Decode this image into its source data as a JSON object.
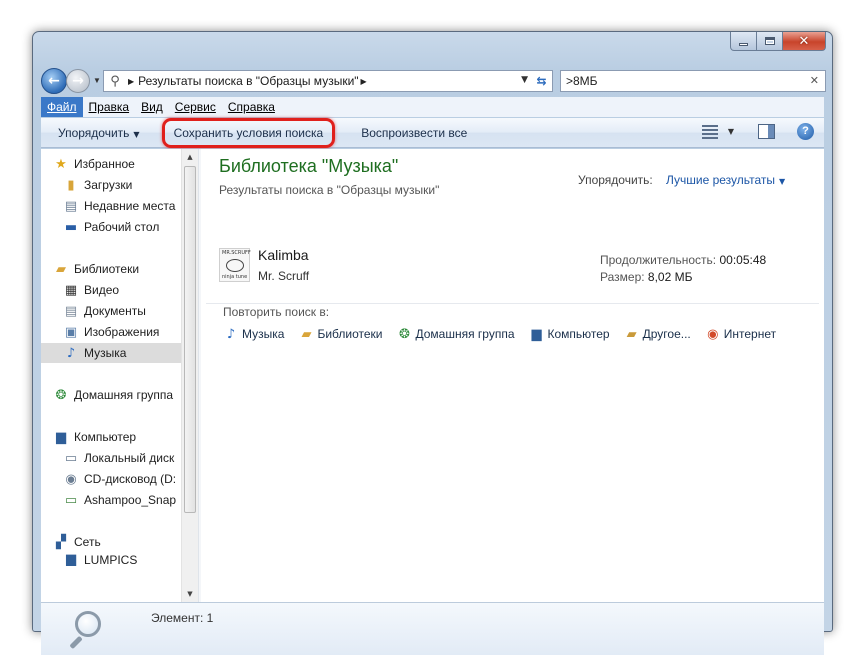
{
  "window": {
    "caption_buttons": [
      "minimize-icon",
      "maximize-icon",
      "close-icon"
    ]
  },
  "address": {
    "crumb": "Результаты поиска в \"Образцы музыки\"",
    "search_value": ">8МБ"
  },
  "menu": {
    "items": [
      "Файл",
      "Правка",
      "Вид",
      "Сервис",
      "Справка"
    ],
    "active": "Файл"
  },
  "toolbar": {
    "organize": "Упорядочить",
    "save_search": "Сохранить условия поиска",
    "play_all": "Воспроизвести все",
    "highlight_color": "#e0201c"
  },
  "navpane": {
    "items": [
      {
        "label": "Избранное",
        "icon": "star-icon"
      },
      {
        "label": "Загрузки",
        "icon": "downloads-folder-icon"
      },
      {
        "label": "Недавние места",
        "icon": "recent-places-icon"
      },
      {
        "label": "Рабочий стол",
        "icon": "desktop-icon"
      },
      {
        "label": "Библиотеки",
        "icon": "libraries-icon"
      },
      {
        "label": "Видео",
        "icon": "video-icon"
      },
      {
        "label": "Документы",
        "icon": "documents-icon"
      },
      {
        "label": "Изображения",
        "icon": "pictures-icon"
      },
      {
        "label": "Музыка",
        "icon": "music-icon",
        "selected": true
      },
      {
        "label": "Домашняя группа",
        "icon": "homegroup-icon"
      },
      {
        "label": "Компьютер",
        "icon": "computer-icon"
      },
      {
        "label": "Локальный диск",
        "icon": "local-disk-icon"
      },
      {
        "label": "CD-дисковод (D:",
        "icon": "cd-drive-icon"
      },
      {
        "label": "Ashampoo_Snap",
        "icon": "network-drive-icon"
      },
      {
        "label": "Сеть",
        "icon": "network-icon"
      },
      {
        "label": "LUMPICS",
        "icon": "pc-icon"
      }
    ]
  },
  "main": {
    "title": "Библиотека \"Музыка\"",
    "subtitle": "Результаты поиска в \"Образцы музыки\"",
    "sort_label": "Упорядочить:",
    "sort_value": "Лучшие результаты",
    "title_color": "#1e6e20",
    "result": {
      "title": "Kalimba",
      "artist": "Mr. Scruff",
      "duration_label": "Продолжительность:",
      "duration": "00:05:48",
      "size_label": "Размер:",
      "size": "8,02 МБ",
      "thumb_top": "MR.SCRUFF",
      "thumb_bottom": "ninja tune"
    },
    "search_again": {
      "label": "Повторить поиск в:",
      "items": [
        {
          "label": "Музыка",
          "icon": "music-icon"
        },
        {
          "label": "Библиотеки",
          "icon": "libraries-icon"
        },
        {
          "label": "Домашняя группа",
          "icon": "homegroup-icon"
        },
        {
          "label": "Компьютер",
          "icon": "computer-icon"
        },
        {
          "label": "Другое...",
          "icon": "other-folder-icon"
        },
        {
          "label": "Интернет",
          "icon": "internet-icon"
        }
      ]
    }
  },
  "status": {
    "text": "Элемент: 1"
  }
}
